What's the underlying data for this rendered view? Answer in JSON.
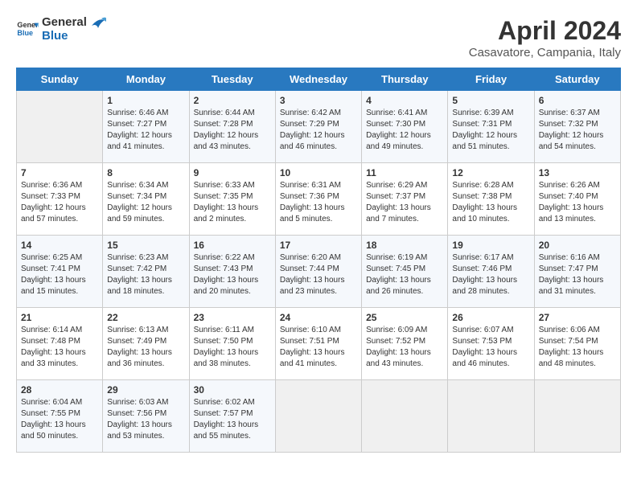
{
  "header": {
    "logo_general": "General",
    "logo_blue": "Blue",
    "month": "April 2024",
    "location": "Casavatore, Campania, Italy"
  },
  "days_of_week": [
    "Sunday",
    "Monday",
    "Tuesday",
    "Wednesday",
    "Thursday",
    "Friday",
    "Saturday"
  ],
  "weeks": [
    [
      {
        "day": "",
        "text": ""
      },
      {
        "day": "1",
        "text": "Sunrise: 6:46 AM\nSunset: 7:27 PM\nDaylight: 12 hours\nand 41 minutes."
      },
      {
        "day": "2",
        "text": "Sunrise: 6:44 AM\nSunset: 7:28 PM\nDaylight: 12 hours\nand 43 minutes."
      },
      {
        "day": "3",
        "text": "Sunrise: 6:42 AM\nSunset: 7:29 PM\nDaylight: 12 hours\nand 46 minutes."
      },
      {
        "day": "4",
        "text": "Sunrise: 6:41 AM\nSunset: 7:30 PM\nDaylight: 12 hours\nand 49 minutes."
      },
      {
        "day": "5",
        "text": "Sunrise: 6:39 AM\nSunset: 7:31 PM\nDaylight: 12 hours\nand 51 minutes."
      },
      {
        "day": "6",
        "text": "Sunrise: 6:37 AM\nSunset: 7:32 PM\nDaylight: 12 hours\nand 54 minutes."
      }
    ],
    [
      {
        "day": "7",
        "text": "Sunrise: 6:36 AM\nSunset: 7:33 PM\nDaylight: 12 hours\nand 57 minutes."
      },
      {
        "day": "8",
        "text": "Sunrise: 6:34 AM\nSunset: 7:34 PM\nDaylight: 12 hours\nand 59 minutes."
      },
      {
        "day": "9",
        "text": "Sunrise: 6:33 AM\nSunset: 7:35 PM\nDaylight: 13 hours\nand 2 minutes."
      },
      {
        "day": "10",
        "text": "Sunrise: 6:31 AM\nSunset: 7:36 PM\nDaylight: 13 hours\nand 5 minutes."
      },
      {
        "day": "11",
        "text": "Sunrise: 6:29 AM\nSunset: 7:37 PM\nDaylight: 13 hours\nand 7 minutes."
      },
      {
        "day": "12",
        "text": "Sunrise: 6:28 AM\nSunset: 7:38 PM\nDaylight: 13 hours\nand 10 minutes."
      },
      {
        "day": "13",
        "text": "Sunrise: 6:26 AM\nSunset: 7:40 PM\nDaylight: 13 hours\nand 13 minutes."
      }
    ],
    [
      {
        "day": "14",
        "text": "Sunrise: 6:25 AM\nSunset: 7:41 PM\nDaylight: 13 hours\nand 15 minutes."
      },
      {
        "day": "15",
        "text": "Sunrise: 6:23 AM\nSunset: 7:42 PM\nDaylight: 13 hours\nand 18 minutes."
      },
      {
        "day": "16",
        "text": "Sunrise: 6:22 AM\nSunset: 7:43 PM\nDaylight: 13 hours\nand 20 minutes."
      },
      {
        "day": "17",
        "text": "Sunrise: 6:20 AM\nSunset: 7:44 PM\nDaylight: 13 hours\nand 23 minutes."
      },
      {
        "day": "18",
        "text": "Sunrise: 6:19 AM\nSunset: 7:45 PM\nDaylight: 13 hours\nand 26 minutes."
      },
      {
        "day": "19",
        "text": "Sunrise: 6:17 AM\nSunset: 7:46 PM\nDaylight: 13 hours\nand 28 minutes."
      },
      {
        "day": "20",
        "text": "Sunrise: 6:16 AM\nSunset: 7:47 PM\nDaylight: 13 hours\nand 31 minutes."
      }
    ],
    [
      {
        "day": "21",
        "text": "Sunrise: 6:14 AM\nSunset: 7:48 PM\nDaylight: 13 hours\nand 33 minutes."
      },
      {
        "day": "22",
        "text": "Sunrise: 6:13 AM\nSunset: 7:49 PM\nDaylight: 13 hours\nand 36 minutes."
      },
      {
        "day": "23",
        "text": "Sunrise: 6:11 AM\nSunset: 7:50 PM\nDaylight: 13 hours\nand 38 minutes."
      },
      {
        "day": "24",
        "text": "Sunrise: 6:10 AM\nSunset: 7:51 PM\nDaylight: 13 hours\nand 41 minutes."
      },
      {
        "day": "25",
        "text": "Sunrise: 6:09 AM\nSunset: 7:52 PM\nDaylight: 13 hours\nand 43 minutes."
      },
      {
        "day": "26",
        "text": "Sunrise: 6:07 AM\nSunset: 7:53 PM\nDaylight: 13 hours\nand 46 minutes."
      },
      {
        "day": "27",
        "text": "Sunrise: 6:06 AM\nSunset: 7:54 PM\nDaylight: 13 hours\nand 48 minutes."
      }
    ],
    [
      {
        "day": "28",
        "text": "Sunrise: 6:04 AM\nSunset: 7:55 PM\nDaylight: 13 hours\nand 50 minutes."
      },
      {
        "day": "29",
        "text": "Sunrise: 6:03 AM\nSunset: 7:56 PM\nDaylight: 13 hours\nand 53 minutes."
      },
      {
        "day": "30",
        "text": "Sunrise: 6:02 AM\nSunset: 7:57 PM\nDaylight: 13 hours\nand 55 minutes."
      },
      {
        "day": "",
        "text": ""
      },
      {
        "day": "",
        "text": ""
      },
      {
        "day": "",
        "text": ""
      },
      {
        "day": "",
        "text": ""
      }
    ]
  ]
}
